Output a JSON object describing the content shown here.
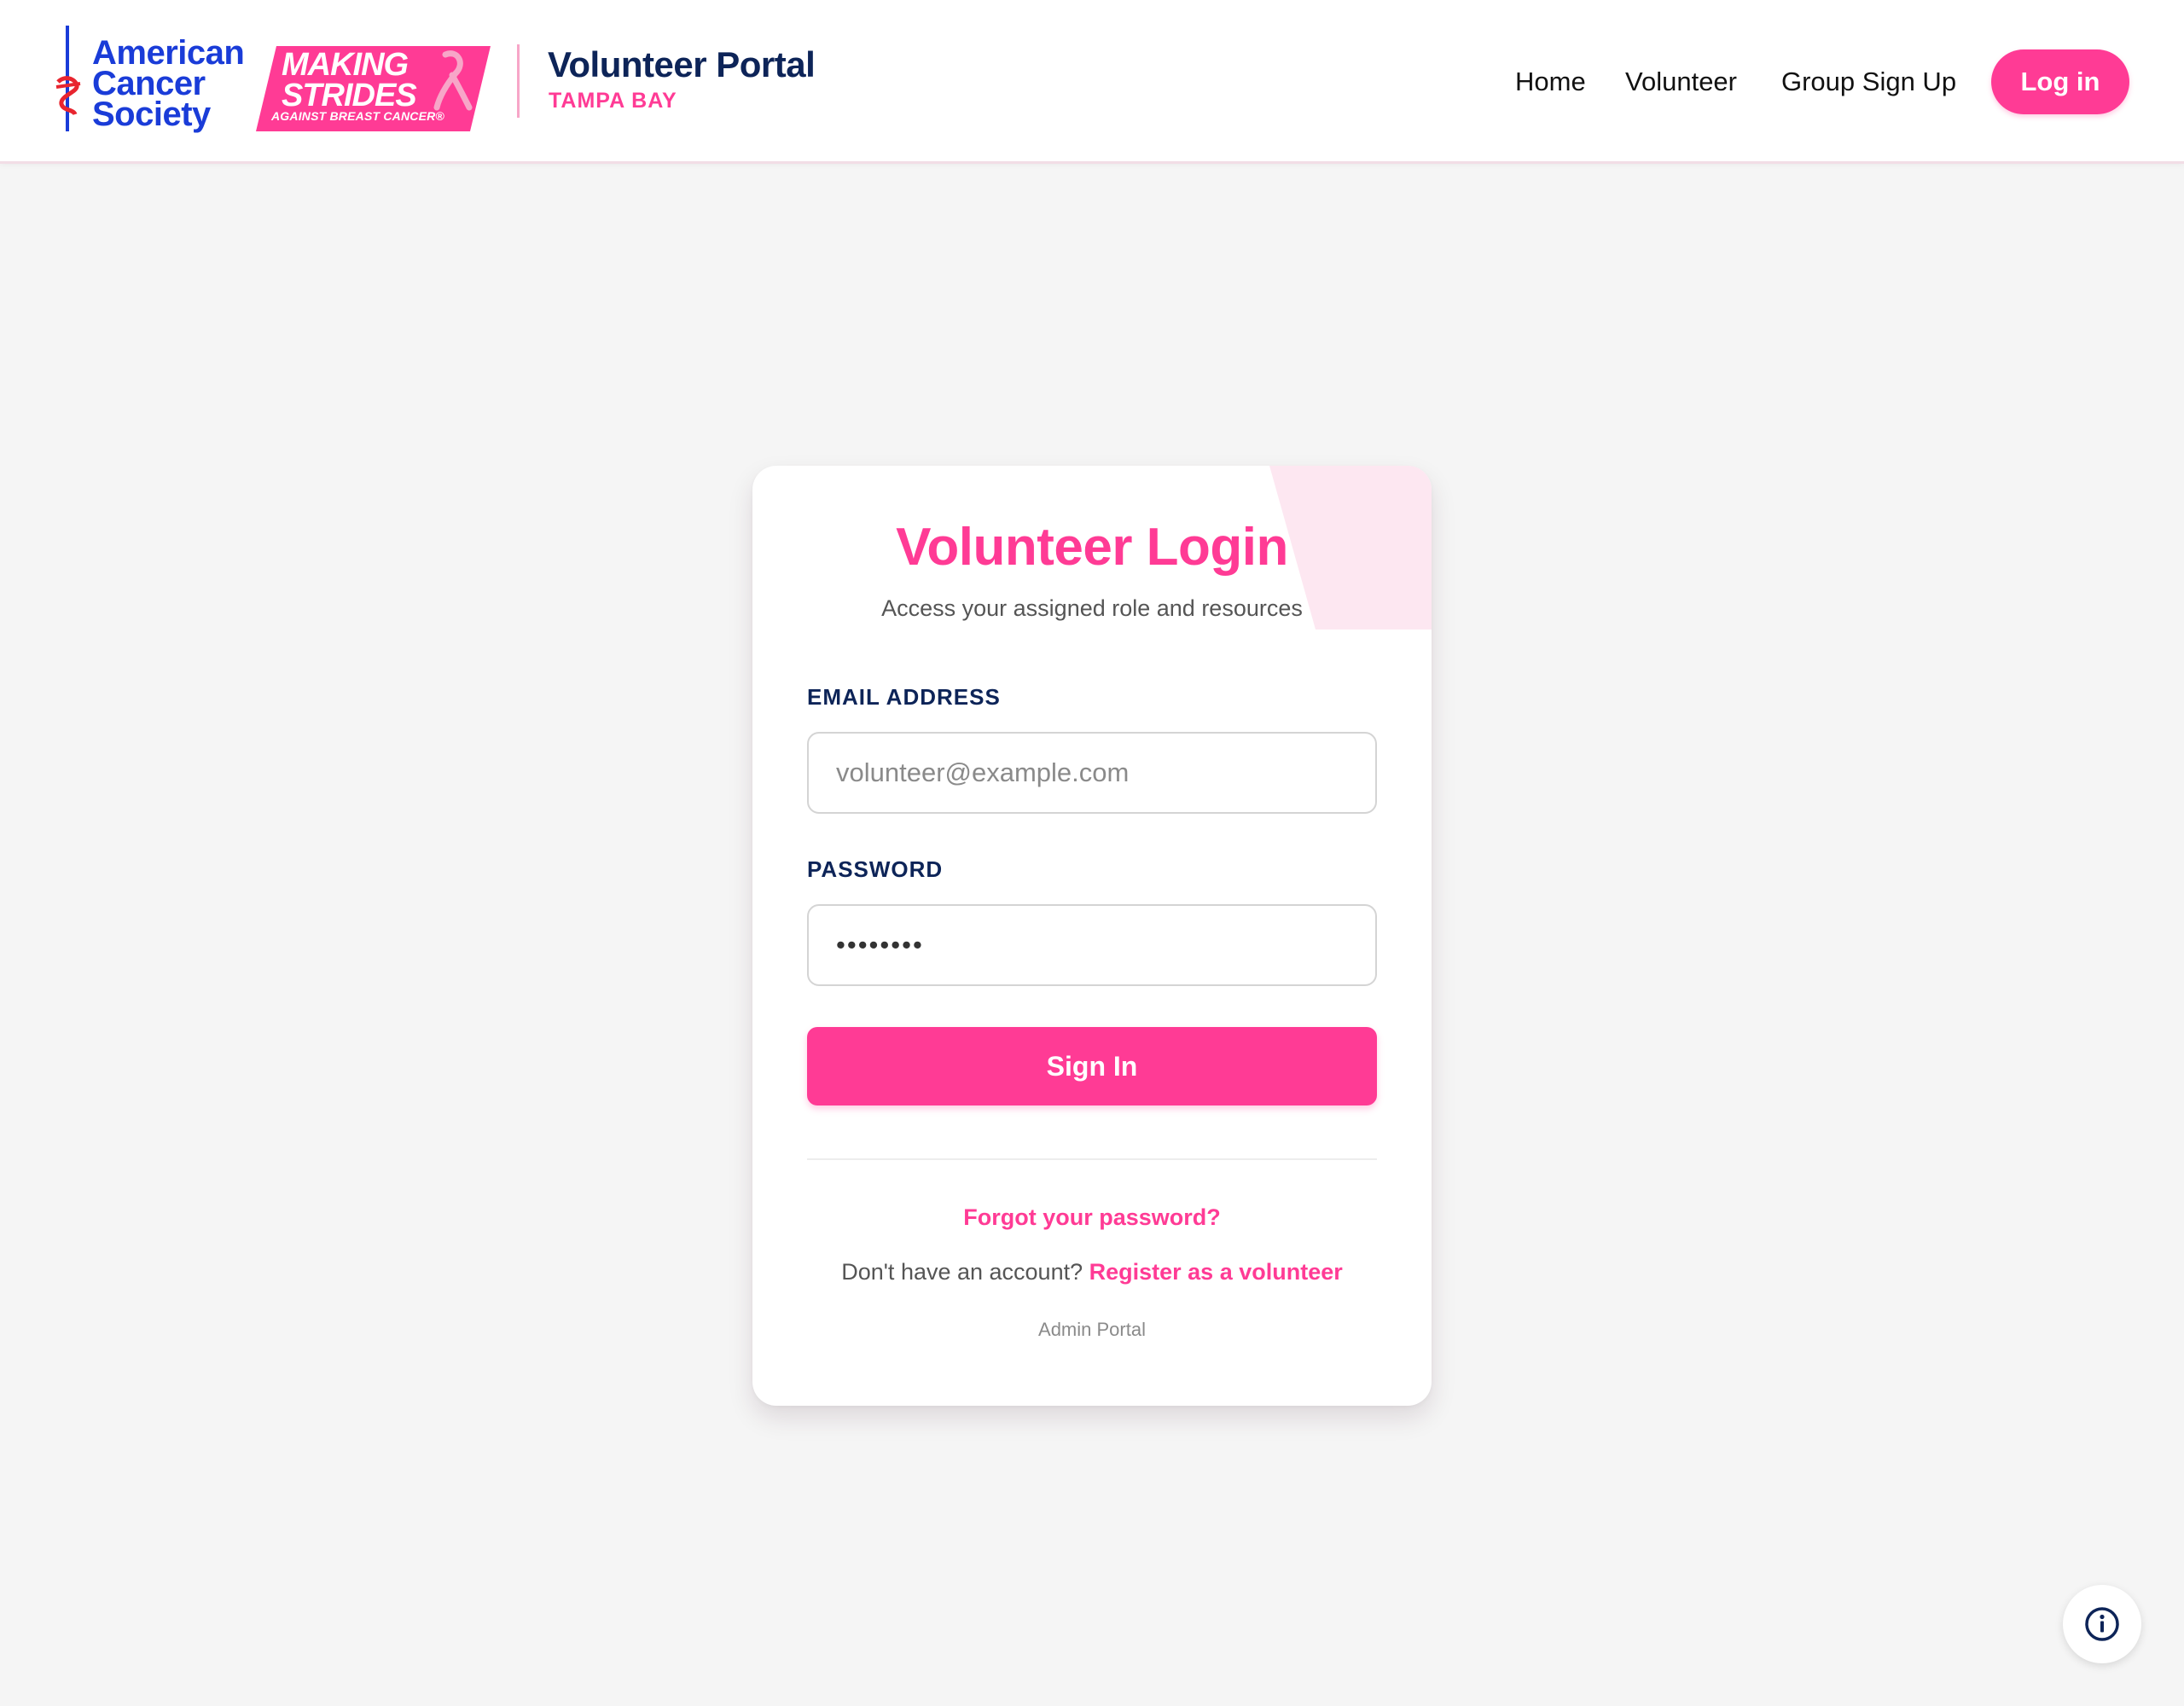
{
  "brand": {
    "acs_lines": [
      "American",
      "Cancer",
      "Society"
    ],
    "making_strides_lines": [
      "MAKING",
      "STRIDES"
    ],
    "making_strides_sub": "AGAINST BREAST CANCER®",
    "portal_title": "Volunteer Portal",
    "portal_location": "TAMPA BAY"
  },
  "nav": {
    "home": "Home",
    "volunteer": "Volunteer",
    "group_sign_up": "Group Sign Up",
    "login": "Log in"
  },
  "login_card": {
    "title": "Volunteer Login",
    "subtitle": "Access your assigned role and resources",
    "email_label": "EMAIL ADDRESS",
    "email_placeholder": "volunteer@example.com",
    "password_label": "PASSWORD",
    "password_value": "••••••••",
    "sign_in": "Sign In",
    "forgot": "Forgot your password?",
    "no_account": "Don't have an account?",
    "register": "Register as a volunteer",
    "admin": "Admin Portal"
  },
  "icons": {
    "info": "info-circle-icon"
  },
  "colors": {
    "accent_pink": "#ff3b95",
    "navy": "#0d2458",
    "acs_blue": "#1a3cd8",
    "background": "#f5f5f5"
  }
}
